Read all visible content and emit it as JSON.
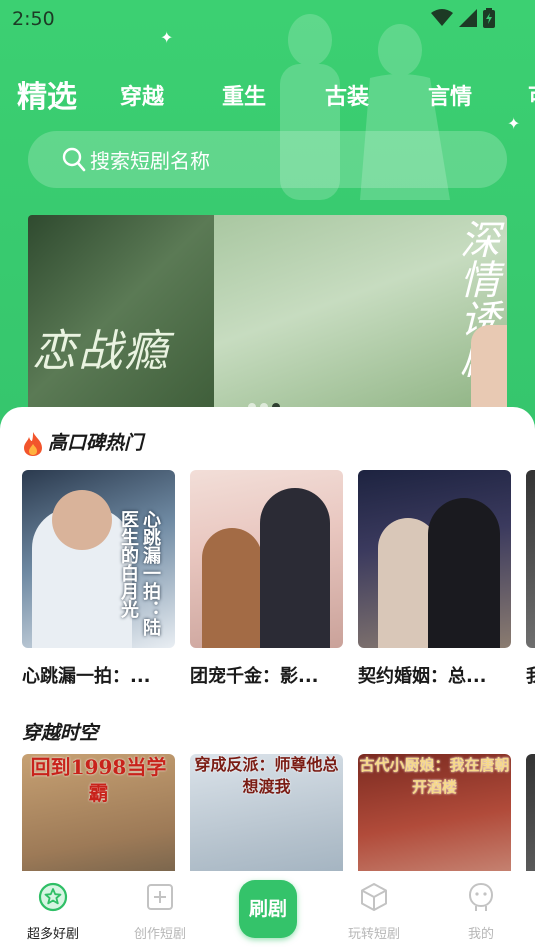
{
  "status_bar": {
    "time": "2:50",
    "icons": [
      "wifi-icon",
      "signal-icon",
      "battery-icon"
    ]
  },
  "tabs": [
    {
      "label": "精选",
      "active": true
    },
    {
      "label": "穿越",
      "active": false
    },
    {
      "label": "重生",
      "active": false
    },
    {
      "label": "古装",
      "active": false
    },
    {
      "label": "言情",
      "active": false
    },
    {
      "label": "可",
      "active": false
    }
  ],
  "search": {
    "placeholder": "搜索短剧名称",
    "icon": "search-icon"
  },
  "banner": {
    "left_title": "恋战瘾",
    "right_title": "深情诱剧",
    "page_count": 3,
    "current_page": 3
  },
  "sections": [
    {
      "title": "高口碑热门",
      "icon": "fire-icon",
      "items": [
        {
          "title": "心跳漏一拍：...",
          "poster_text": "心跳漏一拍：陆医生的白月光"
        },
        {
          "title": "团宠千金：影...",
          "poster_text": ""
        },
        {
          "title": "契约婚姻：总...",
          "poster_text": ""
        },
        {
          "title": "我",
          "poster_text": ""
        }
      ]
    },
    {
      "title": "穿越时空",
      "icon": "",
      "items": [
        {
          "title": "",
          "poster_text": "回到1998当学霸"
        },
        {
          "title": "",
          "poster_text": "穿成反派：师尊他总想渡我"
        },
        {
          "title": "",
          "poster_text": "古代小厨娘：我在唐朝开酒楼"
        }
      ]
    }
  ],
  "bottom_nav": {
    "items": [
      {
        "label": "超多好剧",
        "icon": "star-badge-icon",
        "active": true
      },
      {
        "label": "创作短剧",
        "icon": "add-box-icon",
        "active": false
      },
      {
        "label": "刷剧",
        "icon": "",
        "active": false
      },
      {
        "label": "玩转短剧",
        "icon": "cube-icon",
        "active": false
      },
      {
        "label": "我的",
        "icon": "profile-icon",
        "active": false
      }
    ]
  },
  "colors": {
    "brand": "#37c871",
    "text": "#1a1a1a",
    "inactive": "#b7b7b7"
  }
}
